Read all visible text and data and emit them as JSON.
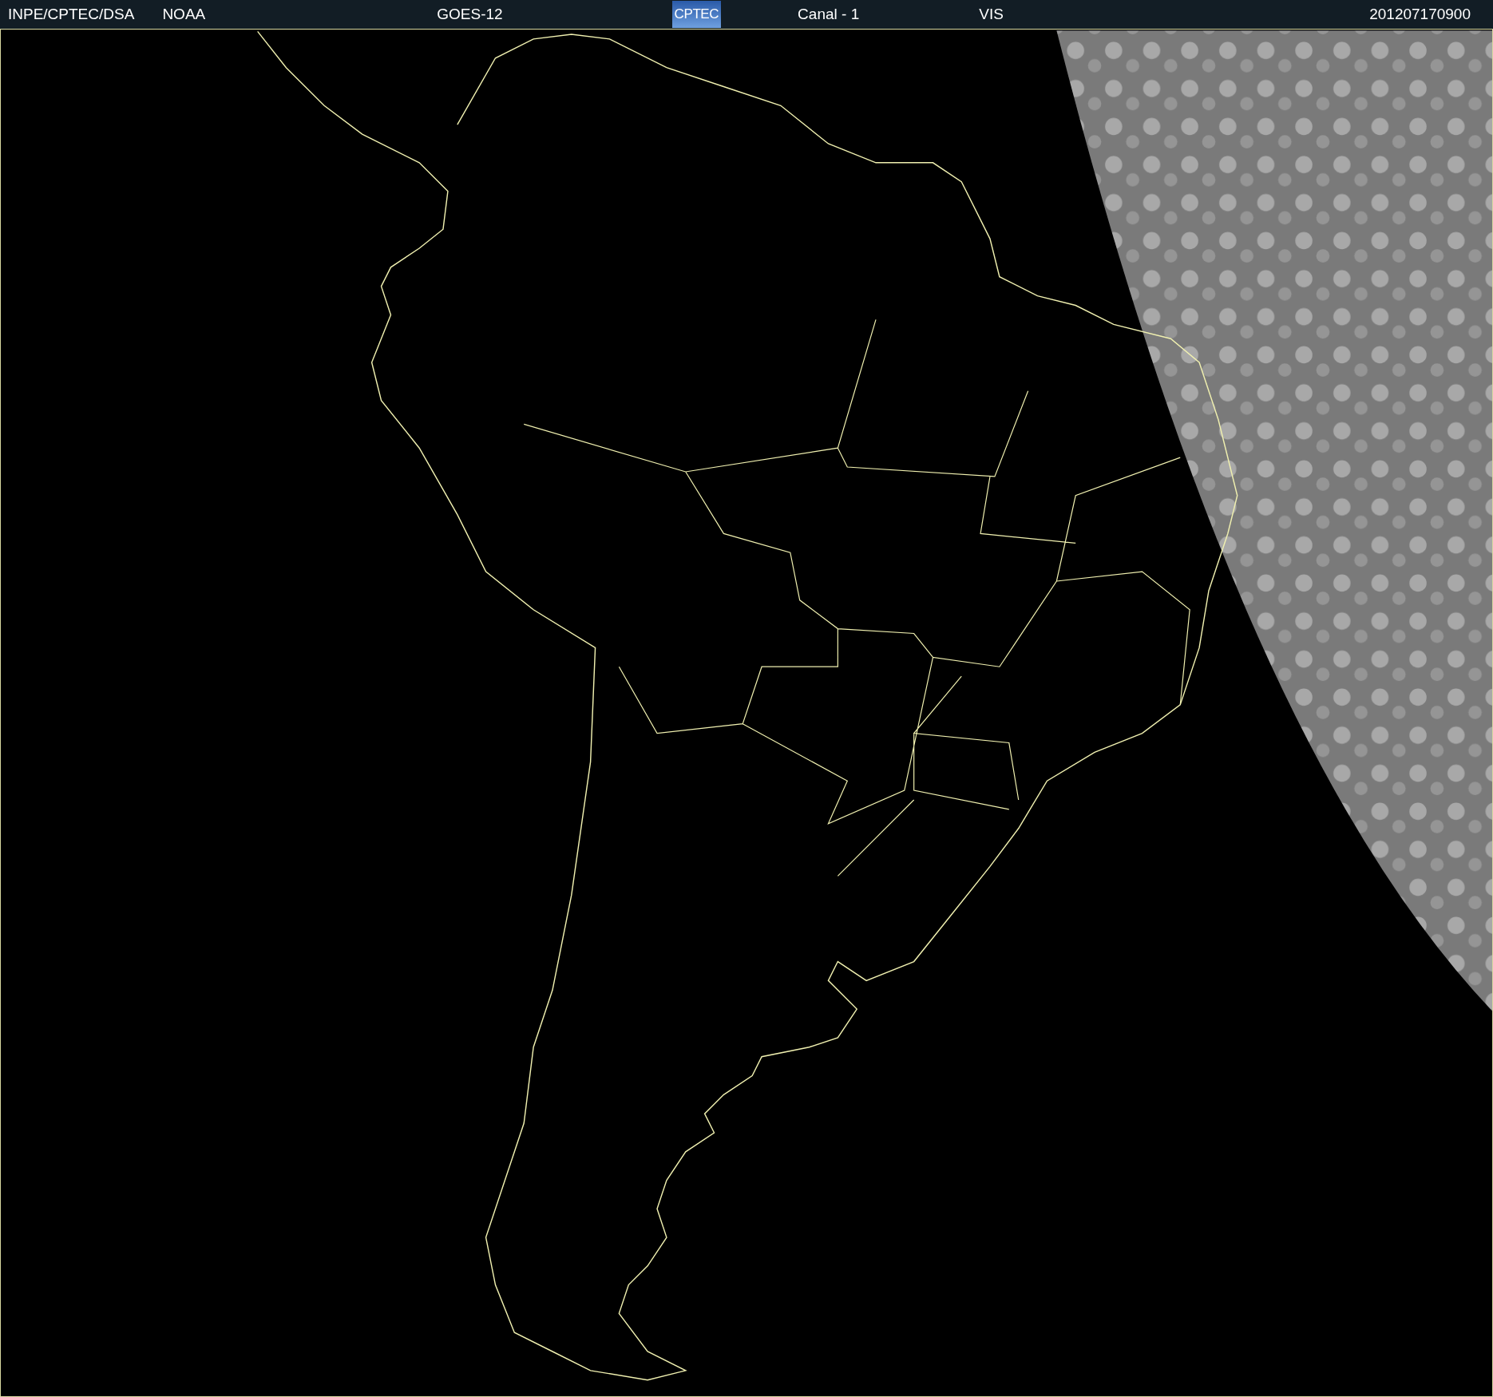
{
  "header": {
    "source": "INPE/CPTEC/DSA",
    "agency": "NOAA",
    "satellite": "GOES-12",
    "logo": "CPTEC",
    "channel": "Canal - 1",
    "band": "VIS",
    "timestamp": "201207170900"
  }
}
